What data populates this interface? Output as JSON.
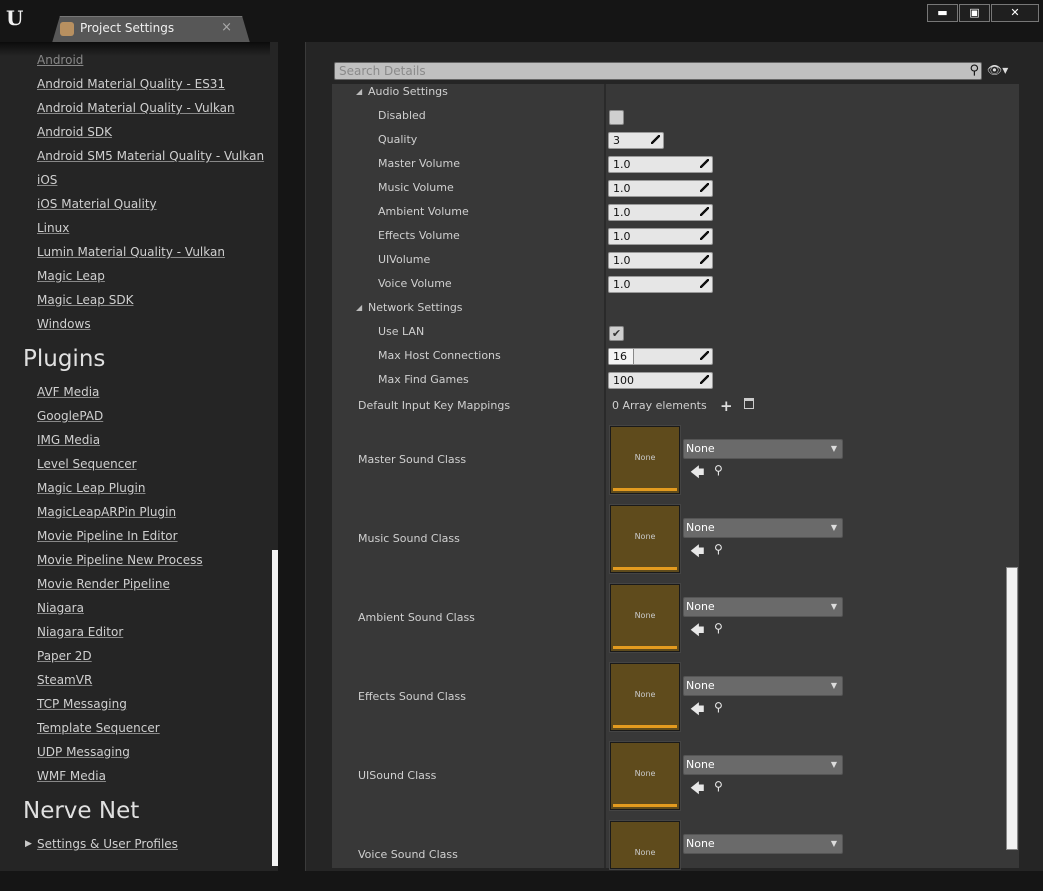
{
  "window": {
    "logo": "U",
    "tab_title": "Project Settings",
    "tab_close": "×",
    "buttons": {
      "minimize": "▬",
      "maximize": "▣",
      "close": "✕"
    }
  },
  "sidebar": {
    "cut_item": "Android",
    "platform_items": [
      "Android Material Quality - ES31",
      "Android Material Quality - Vulkan",
      "Android SDK",
      "Android SM5 Material Quality - Vulkan",
      "iOS",
      "iOS Material Quality",
      "Linux",
      "Lumin Material Quality - Vulkan",
      "Magic Leap",
      "Magic Leap SDK",
      "Windows"
    ],
    "plugins_header": "Plugins",
    "plugin_items": [
      "AVF Media",
      "GooglePAD",
      "IMG Media",
      "Level Sequencer",
      "Magic Leap Plugin",
      "MagicLeapARPin Plugin",
      "Movie Pipeline In Editor",
      "Movie Pipeline New Process",
      "Movie Render Pipeline",
      "Niagara",
      "Niagara Editor",
      "Paper 2D",
      "SteamVR",
      "TCP Messaging",
      "Template Sequencer",
      "UDP Messaging",
      "WMF Media"
    ],
    "nervenet_header": "Nerve Net",
    "nervenet_items": [
      "Settings & User Profiles"
    ]
  },
  "search": {
    "placeholder": "Search Details"
  },
  "audio": {
    "section_label": "Audio Settings",
    "disabled_label": "Disabled",
    "disabled_checked": false,
    "quality_label": "Quality",
    "quality_value": "3",
    "volumes": [
      {
        "label": "Master Volume",
        "value": "1.0"
      },
      {
        "label": "Music Volume",
        "value": "1.0"
      },
      {
        "label": "Ambient Volume",
        "value": "1.0"
      },
      {
        "label": "Effects Volume",
        "value": "1.0"
      },
      {
        "label": "UIVolume",
        "value": "1.0"
      },
      {
        "label": "Voice Volume",
        "value": "1.0"
      }
    ]
  },
  "network": {
    "section_label": "Network Settings",
    "use_lan_label": "Use LAN",
    "use_lan_checked": true,
    "check_mark": "✔",
    "max_host_label": "Max Host Connections",
    "max_host_value": "16",
    "max_find_label": "Max Find Games",
    "max_find_value": "100"
  },
  "input": {
    "label": "Default Input Key Mappings",
    "array_text": "0 Array elements",
    "add_glyph": "+"
  },
  "sound_classes": [
    {
      "label": "Master Sound Class",
      "thumb": "None",
      "value": "None"
    },
    {
      "label": "Music Sound Class",
      "thumb": "None",
      "value": "None"
    },
    {
      "label": "Ambient Sound Class",
      "thumb": "None",
      "value": "None"
    },
    {
      "label": "Effects Sound Class",
      "thumb": "None",
      "value": "None"
    },
    {
      "label": "UISound Class",
      "thumb": "None",
      "value": "None"
    },
    {
      "label": "Voice Sound Class",
      "thumb": "None",
      "value": "None"
    }
  ],
  "glyphs": {
    "section_caret": "◢",
    "tree_caret": "▶",
    "combo_caret": "▼",
    "back": "🡄",
    "find": "⚲",
    "eye": "👁▾"
  },
  "colors": {
    "thumb_bg": "#5f4b1c",
    "thumb_bar": "#e39b1f",
    "panel_bg": "#383838"
  }
}
